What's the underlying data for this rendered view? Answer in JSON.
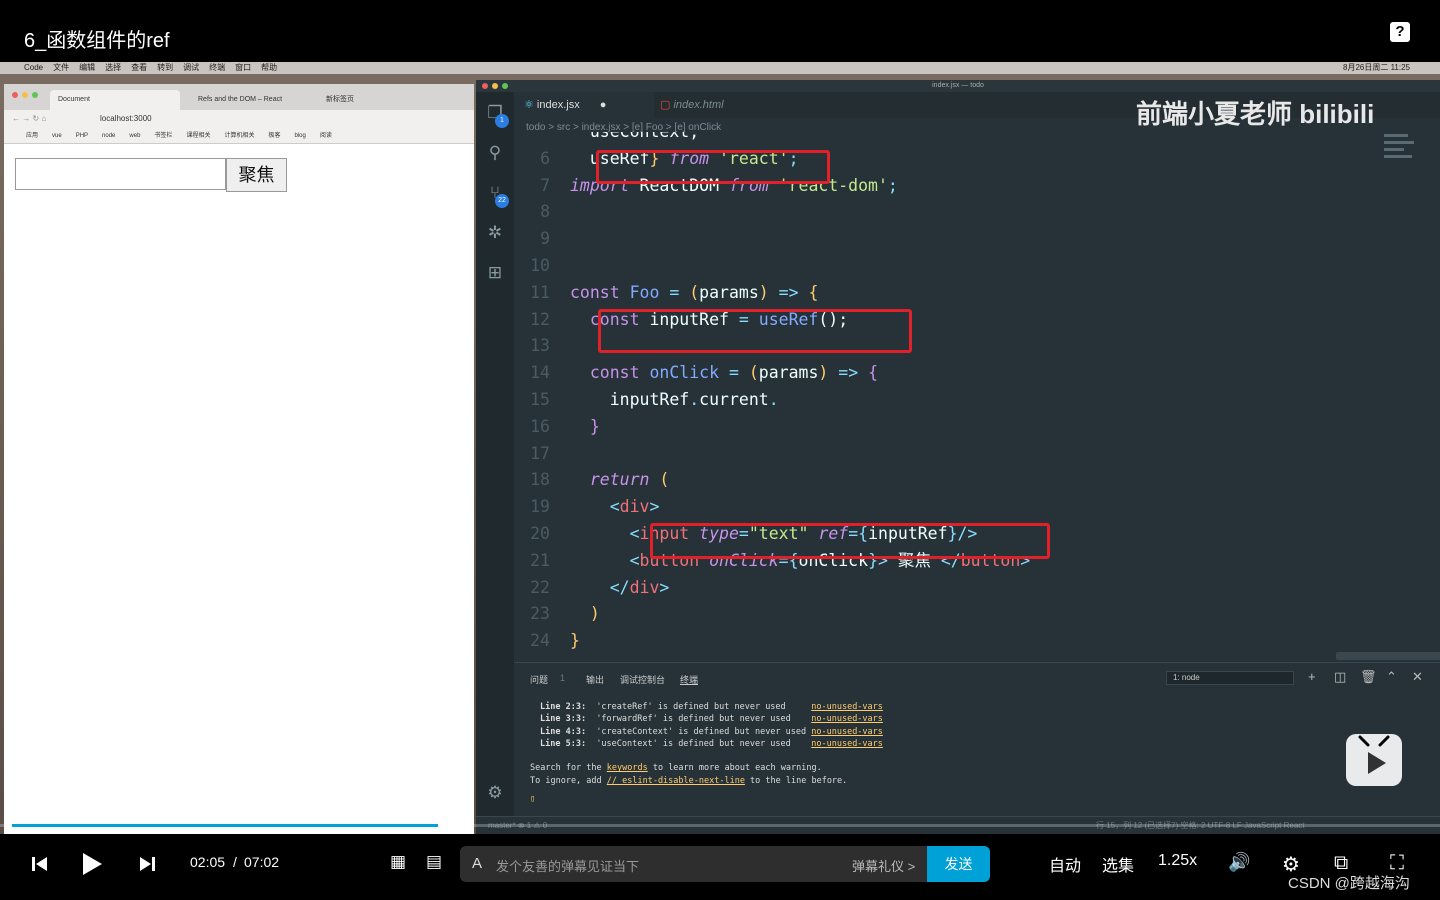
{
  "player": {
    "title": "6_函数组件的ref",
    "time_current": "02:05",
    "time_separator": "/",
    "time_total": "07:02",
    "progress": 0.296,
    "danmaku_placeholder": "发个友善的弹幕见证当下",
    "danmaku_etiquette": "弹幕礼仪 >",
    "send_label": "发送",
    "auto_label": "自动",
    "episodes_label": "选集",
    "speed_label": "1.25x",
    "credit": "CSDN @跨越海沟"
  },
  "mac_menubar": {
    "items": [
      "Code",
      "文件",
      "编辑",
      "选择",
      "查看",
      "转到",
      "调试",
      "终端",
      "窗口",
      "帮助"
    ],
    "status": "8月26日周二 11:25"
  },
  "browser": {
    "tabs": [
      "Document",
      "Refs and the DOM – React",
      "新标签页"
    ],
    "url": "localhost:3000",
    "bookmarks": [
      "应用",
      "vue",
      "PHP",
      "node",
      "web",
      "书签栏",
      "课程相关",
      "计算机相关",
      "极客",
      "blog",
      "阅读"
    ],
    "page_button_label": "聚焦"
  },
  "vscode": {
    "window_title": "index.jsx — todo",
    "tabs": [
      "index.jsx",
      "index.html"
    ],
    "activity_badges": [
      "1",
      "22"
    ],
    "breadcrumb": "todo > src > index.jsx > [e] Foo > [e] onClick",
    "watermark": "前端小夏老师 bilibili",
    "panel_tabs": [
      "问题",
      "1",
      "输出",
      "调试控制台",
      "终端"
    ],
    "terminal_select": "1: node",
    "status_left": "master*   ⊗ 1 ⚠ 0",
    "status_right": "行 15，列 12 (已选择7)   空格: 2   UTF-8   LF   JavaScript React"
  },
  "terminal": {
    "lines": [
      {
        "loc": "Line 2:3:",
        "msg": "'createRef' is defined but never used     ",
        "rule": "no-unused-vars"
      },
      {
        "loc": "Line 3:3:",
        "msg": "'forwardRef' is defined but never used    ",
        "rule": "no-unused-vars"
      },
      {
        "loc": "Line 4:3:",
        "msg": "'createContext' is defined but never used ",
        "rule": "no-unused-vars"
      },
      {
        "loc": "Line 5:3:",
        "msg": "'useContext' is defined but never used    ",
        "rule": "no-unused-vars"
      }
    ],
    "search_prefix": "Search for the ",
    "search_link": "keywords",
    "search_suffix": " to learn more about each warning.",
    "ignore_prefix": "To ignore, add ",
    "ignore_link": "// eslint-disable-next-line",
    "ignore_suffix": " to the line before."
  },
  "code_lines": [
    {
      "n": "",
      "tokens": [
        {
          "t": "  useContext,",
          "c": "var"
        }
      ]
    },
    {
      "n": "6",
      "tokens": [
        {
          "t": "  useRef",
          "c": "var"
        },
        {
          "t": "}",
          "c": "br"
        },
        {
          "t": " ",
          "c": "var"
        },
        {
          "t": "from",
          "c": "kwi"
        },
        {
          "t": " ",
          "c": "var"
        },
        {
          "t": "'react'",
          "c": "str"
        },
        {
          "t": ";",
          "c": "op"
        }
      ]
    },
    {
      "n": "7",
      "tokens": [
        {
          "t": "import",
          "c": "kwi"
        },
        {
          "t": " ReactDOM ",
          "c": "var"
        },
        {
          "t": "from",
          "c": "kwi"
        },
        {
          "t": " ",
          "c": "var"
        },
        {
          "t": "'react-dom'",
          "c": "str"
        },
        {
          "t": ";",
          "c": "op"
        }
      ]
    },
    {
      "n": "8",
      "tokens": []
    },
    {
      "n": "9",
      "tokens": []
    },
    {
      "n": "10",
      "tokens": []
    },
    {
      "n": "11",
      "tokens": [
        {
          "t": "const",
          "c": "kw"
        },
        {
          "t": " ",
          "c": "var"
        },
        {
          "t": "Foo",
          "c": "fn"
        },
        {
          "t": " = ",
          "c": "op"
        },
        {
          "t": "(",
          "c": "br"
        },
        {
          "t": "params",
          "c": "var"
        },
        {
          "t": ")",
          "c": "br"
        },
        {
          "t": " => ",
          "c": "op"
        },
        {
          "t": "{",
          "c": "br"
        }
      ]
    },
    {
      "n": "12",
      "tokens": [
        {
          "t": "  const",
          "c": "kw"
        },
        {
          "t": " inputRef ",
          "c": "var"
        },
        {
          "t": "=",
          "c": "op"
        },
        {
          "t": " ",
          "c": "var"
        },
        {
          "t": "useRef",
          "c": "fn"
        },
        {
          "t": "();",
          "c": "var"
        }
      ]
    },
    {
      "n": "13",
      "tokens": []
    },
    {
      "n": "14",
      "tokens": [
        {
          "t": "  const",
          "c": "kw"
        },
        {
          "t": " ",
          "c": "var"
        },
        {
          "t": "onClick",
          "c": "fn"
        },
        {
          "t": " = ",
          "c": "op"
        },
        {
          "t": "(",
          "c": "br"
        },
        {
          "t": "params",
          "c": "var"
        },
        {
          "t": ")",
          "c": "br"
        },
        {
          "t": " => ",
          "c": "op"
        },
        {
          "t": "{",
          "c": "kw"
        }
      ]
    },
    {
      "n": "15",
      "tokens": [
        {
          "t": "    inputRef",
          "c": "var"
        },
        {
          "t": ".",
          "c": "op"
        },
        {
          "t": "current",
          "c": "var"
        },
        {
          "t": ".",
          "c": "op"
        }
      ]
    },
    {
      "n": "16",
      "tokens": [
        {
          "t": "  }",
          "c": "kw"
        }
      ]
    },
    {
      "n": "17",
      "tokens": []
    },
    {
      "n": "18",
      "tokens": [
        {
          "t": "  return",
          "c": "kwi"
        },
        {
          "t": " (",
          "c": "br"
        }
      ]
    },
    {
      "n": "19",
      "tokens": [
        {
          "t": "    <",
          "c": "op"
        },
        {
          "t": "div",
          "c": "tag"
        },
        {
          "t": ">",
          "c": "op"
        }
      ]
    },
    {
      "n": "20",
      "tokens": [
        {
          "t": "      <",
          "c": "op"
        },
        {
          "t": "input",
          "c": "tag"
        },
        {
          "t": " ",
          "c": "var"
        },
        {
          "t": "type",
          "c": "attr"
        },
        {
          "t": "=",
          "c": "op"
        },
        {
          "t": "\"text\"",
          "c": "str"
        },
        {
          "t": " ",
          "c": "var"
        },
        {
          "t": "ref",
          "c": "attr"
        },
        {
          "t": "={",
          "c": "op"
        },
        {
          "t": "inputRef",
          "c": "var"
        },
        {
          "t": "}/>",
          "c": "op"
        }
      ]
    },
    {
      "n": "21",
      "tokens": [
        {
          "t": "      <",
          "c": "op"
        },
        {
          "t": "button",
          "c": "tag"
        },
        {
          "t": " ",
          "c": "var"
        },
        {
          "t": "onClick",
          "c": "attr"
        },
        {
          "t": "={",
          "c": "op"
        },
        {
          "t": "onClick",
          "c": "var"
        },
        {
          "t": "}>",
          "c": "op"
        },
        {
          "t": " 聚焦 ",
          "c": "var"
        },
        {
          "t": "</",
          "c": "op"
        },
        {
          "t": "button",
          "c": "tag"
        },
        {
          "t": ">",
          "c": "op"
        }
      ]
    },
    {
      "n": "22",
      "tokens": [
        {
          "t": "    </",
          "c": "op"
        },
        {
          "t": "div",
          "c": "tag"
        },
        {
          "t": ">",
          "c": "op"
        }
      ]
    },
    {
      "n": "23",
      "tokens": [
        {
          "t": "  )",
          "c": "br"
        }
      ]
    },
    {
      "n": "24",
      "tokens": [
        {
          "t": "}",
          "c": "br"
        }
      ]
    }
  ],
  "colors": {
    "accent": "#00a1d6",
    "highlight_box": "#e0212a",
    "editor_bg": "#263238"
  }
}
